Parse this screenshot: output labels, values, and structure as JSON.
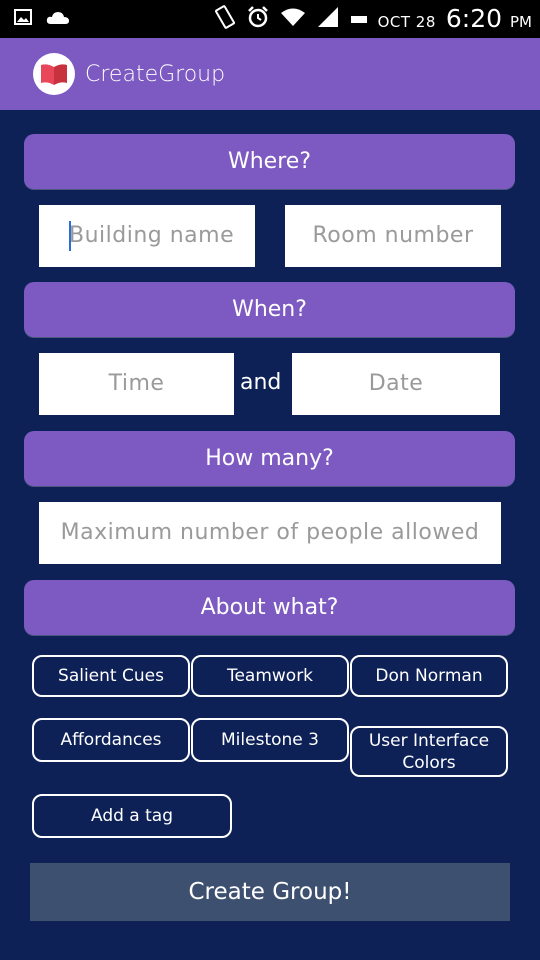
{
  "status_bar": {
    "date": "OCT 28",
    "time": "6:20",
    "ampm": "PM"
  },
  "app_bar": {
    "title": "CreateGroup"
  },
  "where": {
    "header": "Where?",
    "building_placeholder": "Building name",
    "room_placeholder": "Room number"
  },
  "when": {
    "header": "When?",
    "time_placeholder": "Time",
    "and_label": "and",
    "date_placeholder": "Date"
  },
  "how_many": {
    "header": "How many?",
    "max_placeholder": "Maximum number of people allowed"
  },
  "about": {
    "header": "About what?",
    "tags": [
      "Salient Cues",
      "Teamwork",
      "Don Norman",
      "Affordances",
      "Milestone 3",
      "User Interface Colors"
    ],
    "add_tag_label": "Add a tag"
  },
  "create_button_label": "Create Group!",
  "colors": {
    "accent": "#7d5ac1",
    "background": "#0d2157",
    "button": "#3d5070"
  }
}
